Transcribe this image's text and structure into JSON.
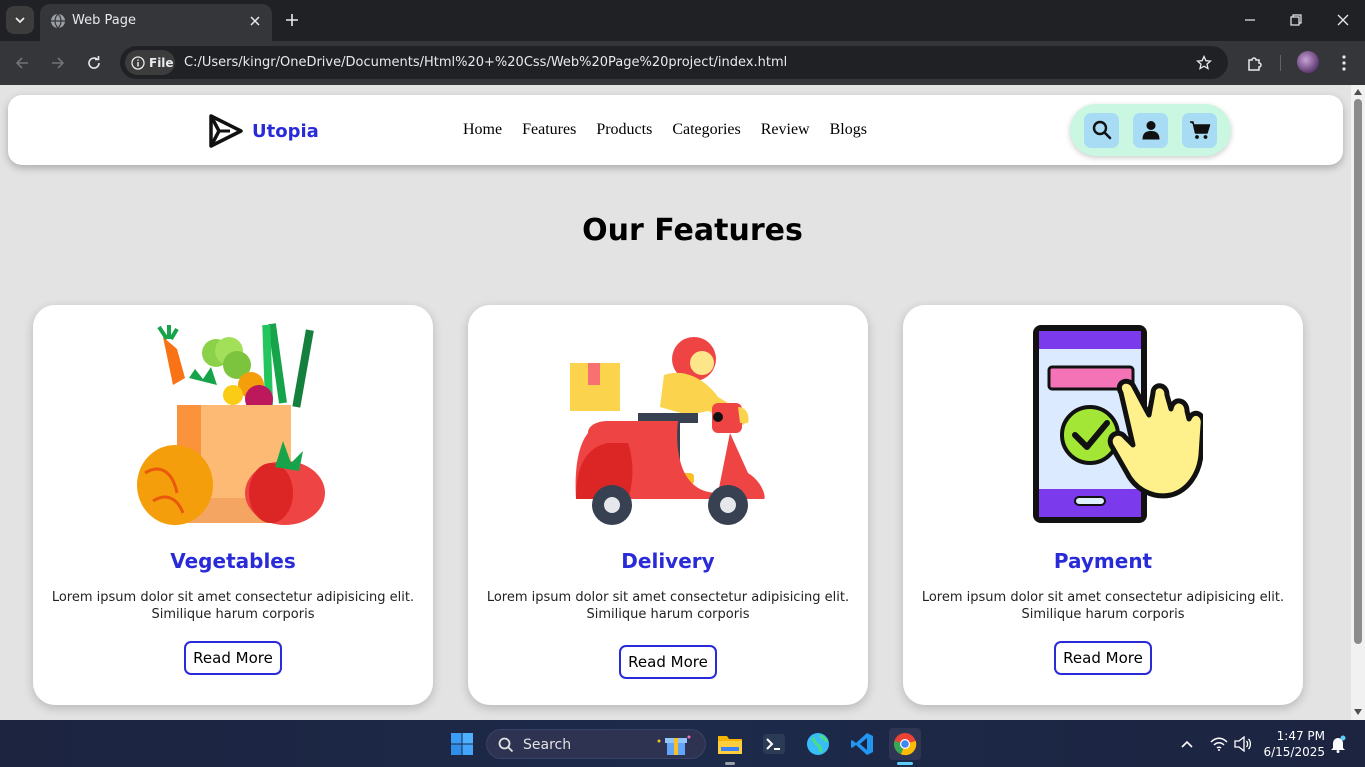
{
  "browser": {
    "tab_title": "Web Page",
    "site_chip": "File",
    "url": "C:/Users/kingr/OneDrive/Documents/Html%20+%20Css/Web%20Page%20project/index.html"
  },
  "header": {
    "logo_text": "Utopia",
    "nav": [
      "Home",
      "Features",
      "Products",
      "Categories",
      "Review",
      "Blogs"
    ]
  },
  "section": {
    "title": "Our Features"
  },
  "cards": [
    {
      "title": "Vegetables",
      "text": "Lorem ipsum dolor sit amet consectetur adipisicing elit. Similique harum corporis",
      "button": "Read More"
    },
    {
      "title": "Delivery",
      "text": "Lorem ipsum dolor sit amet consectetur adipisicing elit. Similique harum corporis",
      "button": "Read More"
    },
    {
      "title": "Payment",
      "text": "Lorem ipsum dolor sit amet consectetur adipisicing elit. Similique harum corporis",
      "button": "Read More"
    }
  ],
  "taskbar": {
    "search_placeholder": "Search",
    "time": "1:47 PM",
    "date": "6/15/2025"
  },
  "colors": {
    "accent": "#2a2bd8",
    "header_icons_bg": "#c9f7e1",
    "icon_button_bg": "#a8dcf4",
    "page_bg": "#e3e3e3"
  }
}
